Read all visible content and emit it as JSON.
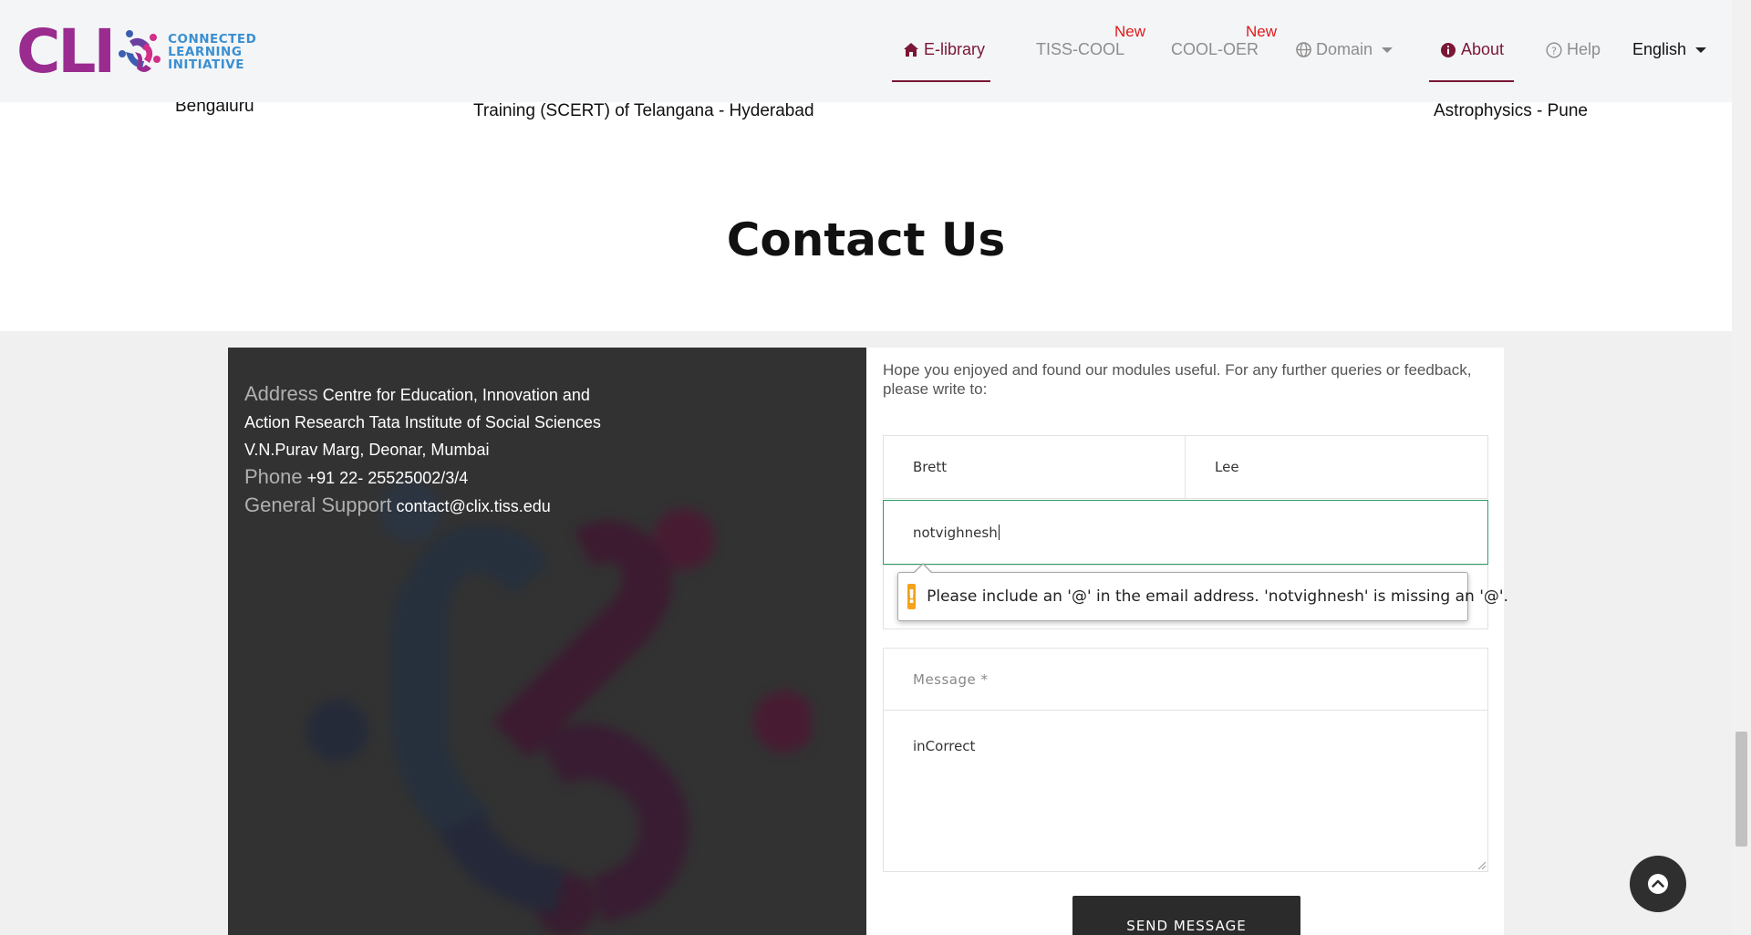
{
  "header": {
    "logo": {
      "wordmark": "CLI",
      "line1": "CONNECTED",
      "line2": "LEARNING",
      "line3": "INITIATIVE"
    },
    "nav": [
      {
        "id": "elibrary",
        "label": "E-library",
        "icon": "home-icon",
        "active": false
      },
      {
        "id": "tiss-cool",
        "label": "TISS-COOL",
        "badge": "New"
      },
      {
        "id": "cool-oer",
        "label": "COOL-OER",
        "badge": "New"
      },
      {
        "id": "domain",
        "label": "Domain",
        "icon": "globe-icon"
      },
      {
        "id": "about",
        "label": "About",
        "icon": "info-icon",
        "active": true
      },
      {
        "id": "help",
        "label": "Help",
        "icon": "help-circle-icon"
      },
      {
        "id": "language",
        "label": "English"
      }
    ],
    "active_color": "#7a1735",
    "badge_color": "#e01a1a"
  },
  "partners": {
    "left": "Bengaluru",
    "center": "Training (SCERT) of Telangana - Hyderabad",
    "right": "Astrophysics - Pune"
  },
  "contact": {
    "title": "Contact Us",
    "address_label": "Address",
    "address_value": "Centre for Education, Innovation and Action Research Tata Institute of Social Sciences V.N.Purav Marg, Deonar, Mumbai",
    "phone_label": "Phone",
    "phone_value": "+91 22- 25525002/3/4",
    "support_label": "General Support",
    "support_value": "contact@clix.tiss.edu"
  },
  "form": {
    "intro": "Hope you enjoyed and found our modules useful. For any further queries or feedback, please write to:",
    "first_name": "Brett",
    "last_name": "Lee",
    "email": "notvighnesh",
    "subject_placeholder": "",
    "message_label": "Message *",
    "message_value": "inCorrect",
    "submit_label": "SEND MESSAGE"
  },
  "validation": {
    "icon": "!",
    "message": "Please include an '@' in the email address. 'notvighnesh' is missing an '@'."
  }
}
